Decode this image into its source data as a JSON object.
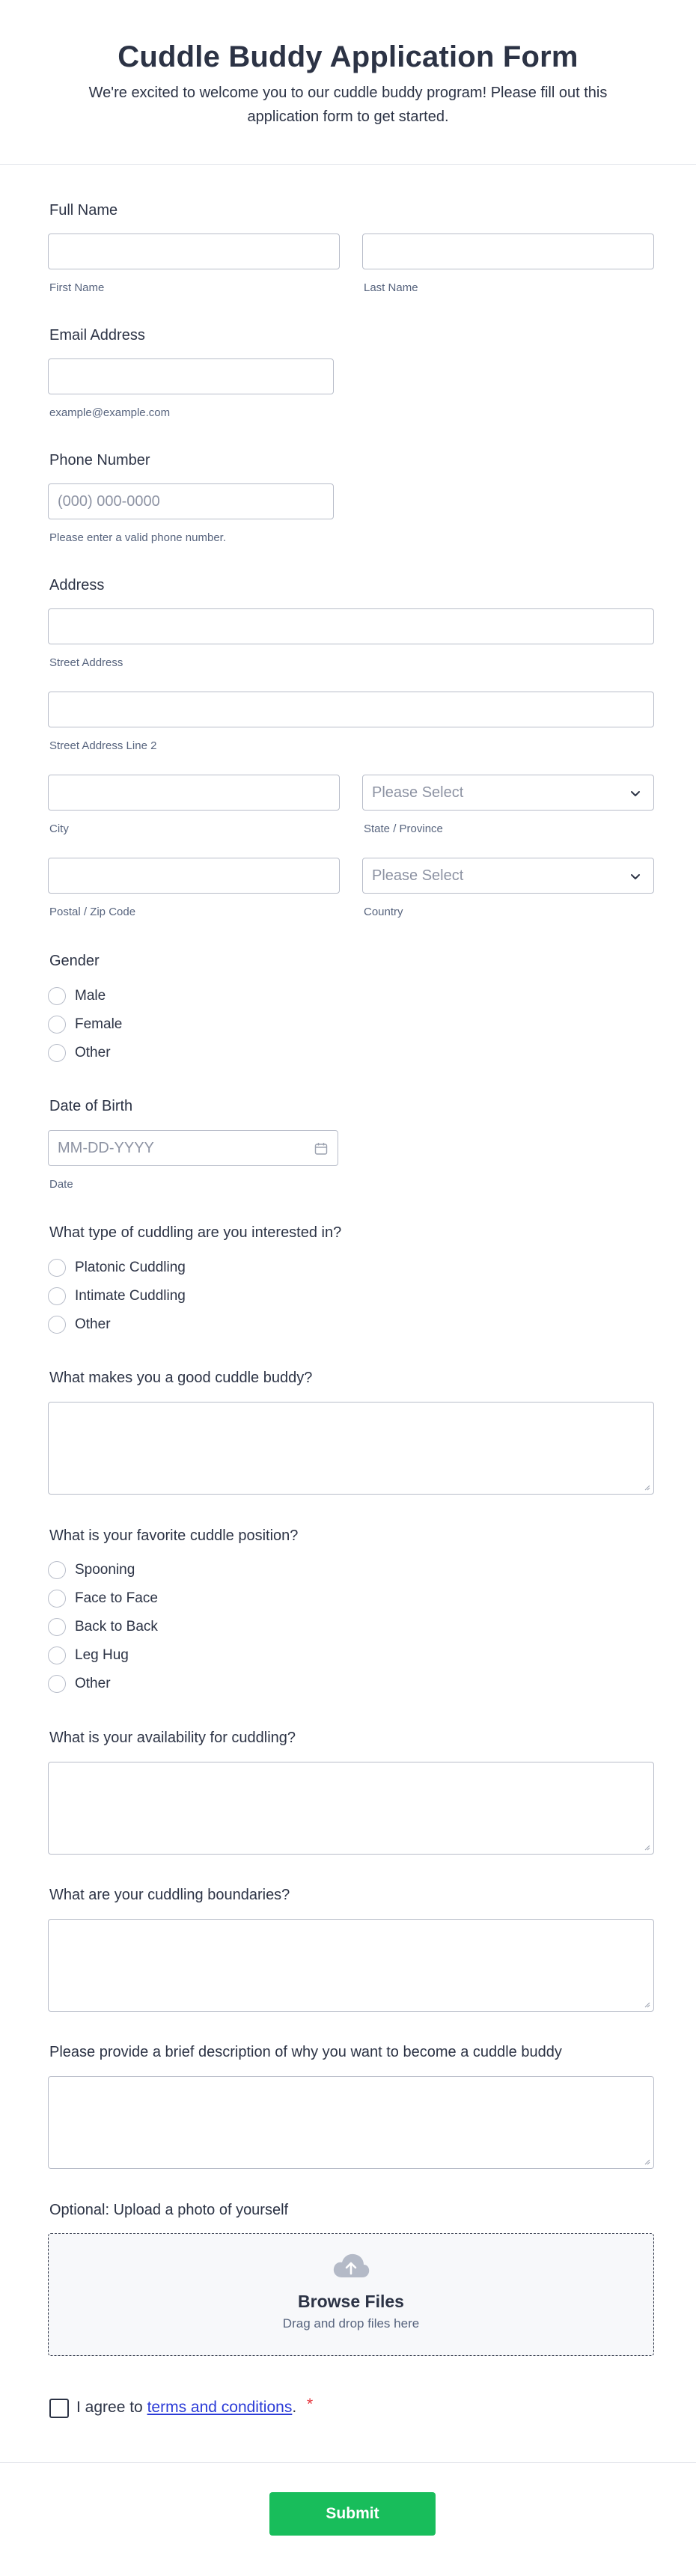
{
  "header": {
    "title": "Cuddle Buddy Application Form",
    "subtitle": "We're excited to welcome you to our cuddle buddy program! Please fill out this application form to get started."
  },
  "full_name": {
    "label": "Full Name",
    "first_sub": "First Name",
    "last_sub": "Last Name"
  },
  "email": {
    "label": "Email Address",
    "sub": "example@example.com"
  },
  "phone": {
    "label": "Phone Number",
    "placeholder": "(000) 000-0000",
    "sub": "Please enter a valid phone number."
  },
  "address": {
    "label": "Address",
    "street_sub": "Street Address",
    "street2_sub": "Street Address Line 2",
    "city_sub": "City",
    "state_placeholder": "Please Select",
    "state_sub": "State / Province",
    "zip_sub": "Postal / Zip Code",
    "country_placeholder": "Please Select",
    "country_sub": "Country"
  },
  "gender": {
    "label": "Gender",
    "options": [
      "Male",
      "Female",
      "Other"
    ]
  },
  "dob": {
    "label": "Date of Birth",
    "placeholder": "MM-DD-YYYY",
    "sub": "Date"
  },
  "cuddling_type": {
    "label": "What type of cuddling are you interested in?",
    "options": [
      "Platonic Cuddling",
      "Intimate Cuddling",
      "Other"
    ]
  },
  "good_buddy": {
    "label": "What makes you a good cuddle buddy?"
  },
  "position": {
    "label": "What is your favorite cuddle position?",
    "options": [
      "Spooning",
      "Face to Face",
      "Back to Back",
      "Leg Hug",
      "Other"
    ]
  },
  "availability": {
    "label": "What is your availability for cuddling?"
  },
  "boundaries": {
    "label": "What are your cuddling boundaries?"
  },
  "description": {
    "label": "Please provide a brief description of why you want to become a cuddle buddy"
  },
  "upload": {
    "label": "Optional: Upload a photo of yourself",
    "title": "Browse Files",
    "sub": "Drag and drop files here",
    "icon": "cloud-upload-icon"
  },
  "agree": {
    "prefix": "I agree to ",
    "link": "terms and conditions",
    "suffix": ".",
    "required_mark": "*"
  },
  "submit": {
    "label": "Submit"
  },
  "colors": {
    "accent": "#18bd5b",
    "text": "#2c3345",
    "link": "#2b3bd7",
    "required": "#e5363d"
  }
}
